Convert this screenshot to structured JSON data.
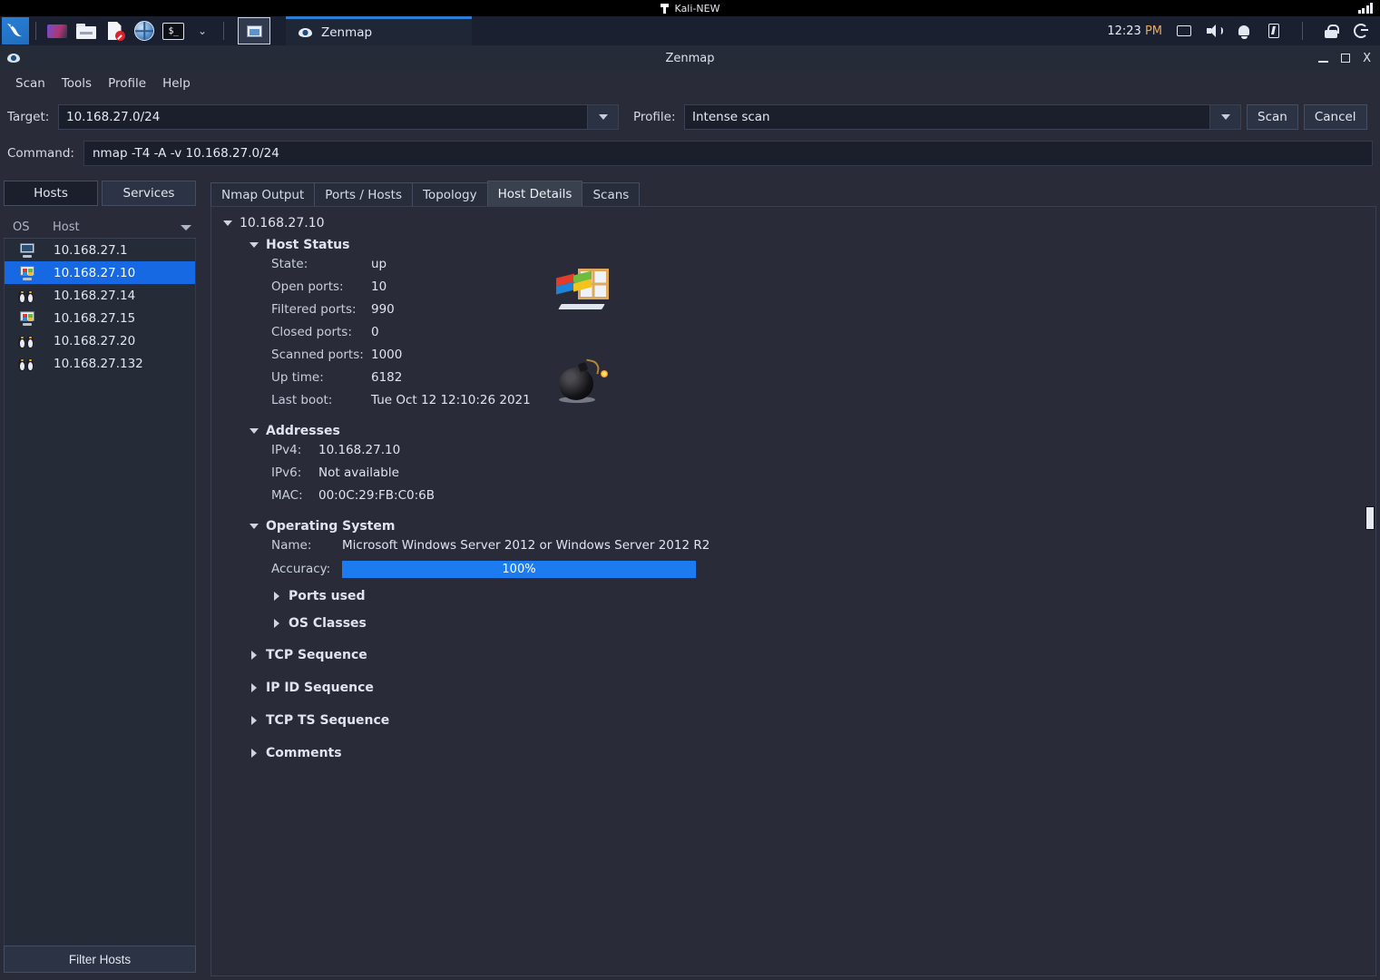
{
  "desktop": {
    "workspace_label": "Kali-NEW",
    "pin_icon": "pin-icon",
    "signal_icon": "signal-strength-icon"
  },
  "taskbar": {
    "launchers": [
      {
        "name": "kali-menu-icon",
        "label": "Kali"
      },
      {
        "name": "workspace-switcher-icon",
        "label": "Workspaces"
      },
      {
        "name": "file-manager-icon",
        "label": "Files"
      },
      {
        "name": "text-editor-icon",
        "label": "Editor"
      },
      {
        "name": "web-browser-icon",
        "label": "Browser"
      },
      {
        "name": "terminal-icon",
        "label": "Terminal"
      },
      {
        "name": "chevron-down-icon",
        "label": "More"
      }
    ],
    "show_desktop_label": "Show Desktop",
    "task_button": {
      "icon": "eye-icon",
      "label": "Zenmap"
    },
    "tray": {
      "clock": "12:23 PM",
      "clock_time": "12:23",
      "clock_meridiem": "PM",
      "icons": [
        {
          "name": "display-icon",
          "label": "Display"
        },
        {
          "name": "volume-icon",
          "label": "Volume"
        },
        {
          "name": "notification-bell-icon",
          "label": "Notifications"
        },
        {
          "name": "battery-icon",
          "label": "Battery"
        },
        {
          "name": "lock-icon",
          "label": "Lock screen"
        },
        {
          "name": "logout-icon",
          "label": "Log out"
        }
      ]
    }
  },
  "window": {
    "title": "Zenmap",
    "icon": "eye-icon",
    "controls": {
      "minimize": "minimize-button",
      "maximize": "maximize-button",
      "close_label": "X"
    }
  },
  "menubar": {
    "items": [
      {
        "label": "Scan"
      },
      {
        "label": "Tools"
      },
      {
        "label": "Profile"
      },
      {
        "label": "Help"
      }
    ]
  },
  "scan_controls": {
    "target_label": "Target:",
    "target_value": "10.168.27.0/24",
    "target_placeholder": "",
    "profile_label": "Profile:",
    "profile_value": "Intense scan",
    "profile_placeholder": "",
    "scan_button": "Scan",
    "cancel_button": "Cancel",
    "command_label": "Command:",
    "command_value": "nmap -T4 -A -v 10.168.27.0/24"
  },
  "sidebar": {
    "tabs": [
      {
        "label": "Hosts",
        "active": true
      },
      {
        "label": "Services",
        "active": false
      }
    ],
    "columns": {
      "os": "OS",
      "host": "Host"
    },
    "hosts": [
      {
        "host": "10.168.27.1",
        "os_icon": "generic-host-icon",
        "selected": false
      },
      {
        "host": "10.168.27.10",
        "os_icon": "windows-host-icon",
        "selected": true
      },
      {
        "host": "10.168.27.14",
        "os_icon": "linux-host-icon",
        "selected": false
      },
      {
        "host": "10.168.27.15",
        "os_icon": "windows-host-icon",
        "selected": false
      },
      {
        "host": "10.168.27.20",
        "os_icon": "linux-host-icon",
        "selected": false
      },
      {
        "host": "10.168.27.132",
        "os_icon": "linux-host-icon",
        "selected": false
      }
    ],
    "filter_button": "Filter Hosts"
  },
  "main": {
    "tabs": [
      {
        "label": "Nmap Output",
        "active": false
      },
      {
        "label": "Ports / Hosts",
        "active": false
      },
      {
        "label": "Topology",
        "active": false
      },
      {
        "label": "Host Details",
        "active": true
      },
      {
        "label": "Scans",
        "active": false
      }
    ],
    "host_details": {
      "root_label": "10.168.27.10",
      "host_status": {
        "title": "Host Status",
        "rows": [
          {
            "key": "State:",
            "value": "up"
          },
          {
            "key": "Open ports:",
            "value": "10"
          },
          {
            "key": "Filtered ports:",
            "value": "990"
          },
          {
            "key": "Closed ports:",
            "value": "0"
          },
          {
            "key": "Scanned ports:",
            "value": "1000"
          },
          {
            "key": "Up time:",
            "value": "6182"
          },
          {
            "key": "Last boot:",
            "value": "Tue Oct 12 12:10:26 2021"
          }
        ],
        "decor_icons": [
          {
            "name": "windows-os-picture",
            "label": "Windows"
          },
          {
            "name": "bomb-picture",
            "label": "Bomb"
          }
        ]
      },
      "addresses": {
        "title": "Addresses",
        "rows": [
          {
            "key": "IPv4:",
            "value": "10.168.27.10"
          },
          {
            "key": "IPv6:",
            "value": "Not available"
          },
          {
            "key": "MAC:",
            "value": "00:0C:29:FB:C0:6B"
          }
        ]
      },
      "operating_system": {
        "title": "Operating System",
        "name_key": "Name:",
        "name_value": "Microsoft Windows Server 2012 or Windows Server 2012 R2",
        "accuracy_key": "Accuracy:",
        "accuracy_value": "100%",
        "accuracy_percent": 100,
        "accuracy_color": "#1d7bf0",
        "subsections": [
          {
            "label": "Ports used"
          },
          {
            "label": "OS Classes"
          }
        ]
      },
      "collapsed_sections": [
        {
          "label": "TCP Sequence"
        },
        {
          "label": "IP ID Sequence"
        },
        {
          "label": "TCP TS Sequence"
        },
        {
          "label": "Comments"
        }
      ]
    }
  },
  "colors": {
    "window_bg": "#292c38",
    "taskbar_bg": "#1b2030",
    "selection_blue": "#1668e3",
    "accent_blue": "#2a7fd4",
    "accuracy_blue": "#1d7bf0"
  }
}
